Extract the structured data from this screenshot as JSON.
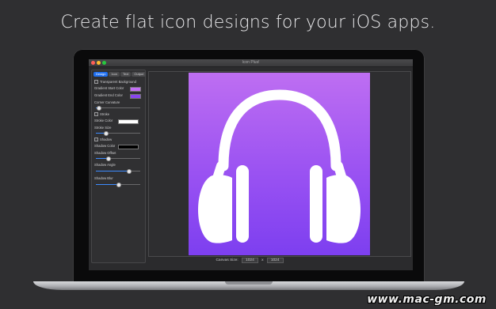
{
  "headline": "Create flat icon designs for your iOS apps.",
  "window": {
    "title": "Icon Plus!"
  },
  "tabs": [
    {
      "label": "Design",
      "active": true
    },
    {
      "label": "Icon"
    },
    {
      "label": "Text"
    },
    {
      "label": "Output"
    }
  ],
  "sidebar": {
    "transparent_bg": "Transparent Background",
    "gradient_start": "Gradient Start Color",
    "gradient_end": "Gradient End Color",
    "corner_curvature": "Corner Curvature",
    "stroke": "Stroke",
    "stroke_color": "Stroke Color",
    "stroke_size": "Stroke Size",
    "shadow": "Shadow",
    "shadow_color": "Shadow Color",
    "shadow_offset": "Shadow Offset",
    "shadow_angle": "Shadow Angle",
    "shadow_blur": "Shadow Blur"
  },
  "sliders": {
    "corner_curvature": 0.05,
    "stroke_size": 0.22,
    "shadow_offset": 0.27,
    "shadow_angle": 0.73,
    "shadow_blur": 0.5
  },
  "colors": {
    "gradient_start": "#c36ef5",
    "gradient_end": "#8a45f1",
    "stroke_color": "#ffffff",
    "shadow_color": "#000000",
    "accent": "#1f6ff0"
  },
  "canvas": {
    "label": "Canvas Size:",
    "width": "1024",
    "x": "x",
    "height": "1024",
    "icon": "headphones-icon"
  },
  "watermark": "www.mac-gm.com"
}
